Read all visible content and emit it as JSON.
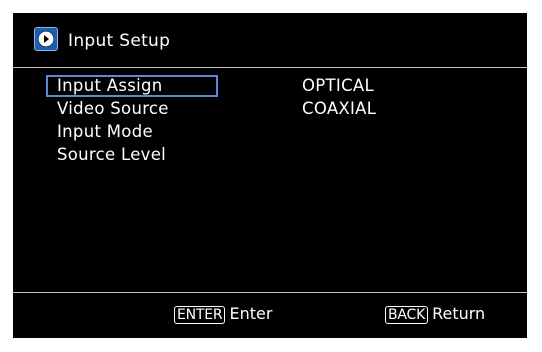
{
  "header": {
    "title": "Input Setup",
    "icon": "arrow-circle-icon"
  },
  "menu": {
    "items": [
      {
        "label": "Input Assign",
        "value": "OPTICAL",
        "selected": true
      },
      {
        "label": "Video Source",
        "value": "COAXIAL",
        "selected": false
      },
      {
        "label": "Input Mode",
        "value": "",
        "selected": false
      },
      {
        "label": "Source Level",
        "value": "",
        "selected": false
      }
    ]
  },
  "footer": {
    "enter_key": "ENTER",
    "enter_label": "Enter",
    "back_key": "BACK",
    "back_label": "Return"
  },
  "colors": {
    "background": "#000000",
    "text": "#ffffff",
    "selection_border": "#5b8ccf",
    "icon_blue": "#1a5fb4"
  }
}
